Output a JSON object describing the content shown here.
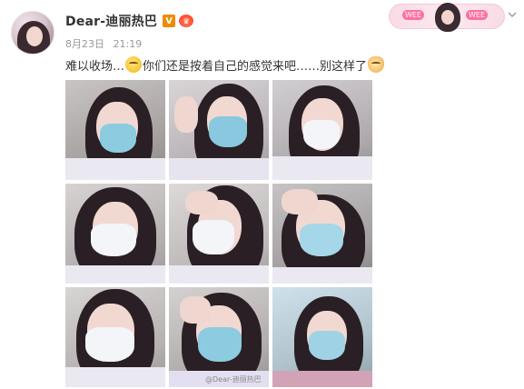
{
  "header": {
    "username": "Dear-迪丽热巴",
    "verified_label": "V",
    "date": "8月23日",
    "time": "21:19"
  },
  "post": {
    "text_part1": "难以收场…",
    "text_part2": "你们还是按着自己的感觉来吧……别这样了",
    "emojis": [
      "sleepy-face-icon",
      "cat-face-icon"
    ]
  },
  "banner": {
    "left_tag": "WEE",
    "right_tag": "WEE"
  },
  "photos": [
    {
      "mask": "blue"
    },
    {
      "mask": "blue"
    },
    {
      "mask": "white"
    },
    {
      "mask": "white"
    },
    {
      "mask": "white"
    },
    {
      "mask": "blue"
    },
    {
      "mask": "white"
    },
    {
      "mask": "blue"
    },
    {
      "mask": "blue"
    }
  ],
  "watermark": "@Dear-迪丽热巴",
  "colors": {
    "username": "#333333",
    "meta": "#999999",
    "verified": "#f08a00",
    "mask_blue": "#8ccbe0",
    "mask_white": "#f3f5f8"
  }
}
